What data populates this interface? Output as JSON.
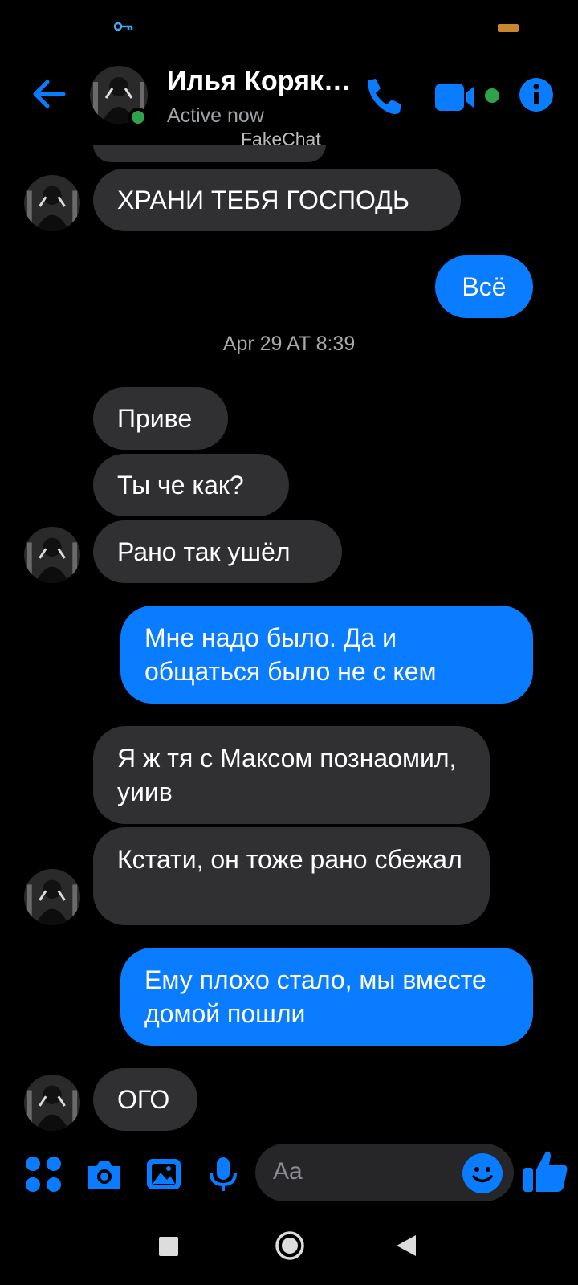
{
  "header": {
    "contact_name": "Илья Коряк…",
    "status": "Active now",
    "watermark": "FakeChat"
  },
  "icons": {
    "back": "back-arrow-icon",
    "call": "phone-icon",
    "video": "video-camera-icon",
    "info": "info-icon",
    "apps": "four-dots-icon",
    "camera": "camera-icon",
    "gallery": "image-icon",
    "mic": "microphone-icon",
    "emoji": "smiley-icon",
    "like": "thumbs-up-icon"
  },
  "colors": {
    "accent": "#0a7cff",
    "incoming_bubble": "#303033",
    "online": "#31a24c",
    "background": "#000000"
  },
  "messages": [
    {
      "dir": "in",
      "text": "ХРАНИ ТЕБЯ ГОСПОДЬ"
    },
    {
      "dir": "out",
      "text": "Всё"
    },
    {
      "dir": "in",
      "text": "Приве"
    },
    {
      "dir": "in",
      "text": "Ты че как?"
    },
    {
      "dir": "in",
      "text": "Рано так ушёл"
    },
    {
      "dir": "out",
      "text": "Мне надо было. Да и общаться было не с кем"
    },
    {
      "dir": "in",
      "text": "Я ж тя с Максом познаомил, уиив"
    },
    {
      "dir": "in",
      "text": "Кстати, он тоже рано сбежал"
    },
    {
      "dir": "out",
      "text": "Ему плохо стало, мы вместе домой пошли"
    },
    {
      "dir": "in",
      "text": "ОГО"
    }
  ],
  "timestamp": "Apr 29 AT 8:39",
  "composer": {
    "placeholder": "Aa"
  }
}
